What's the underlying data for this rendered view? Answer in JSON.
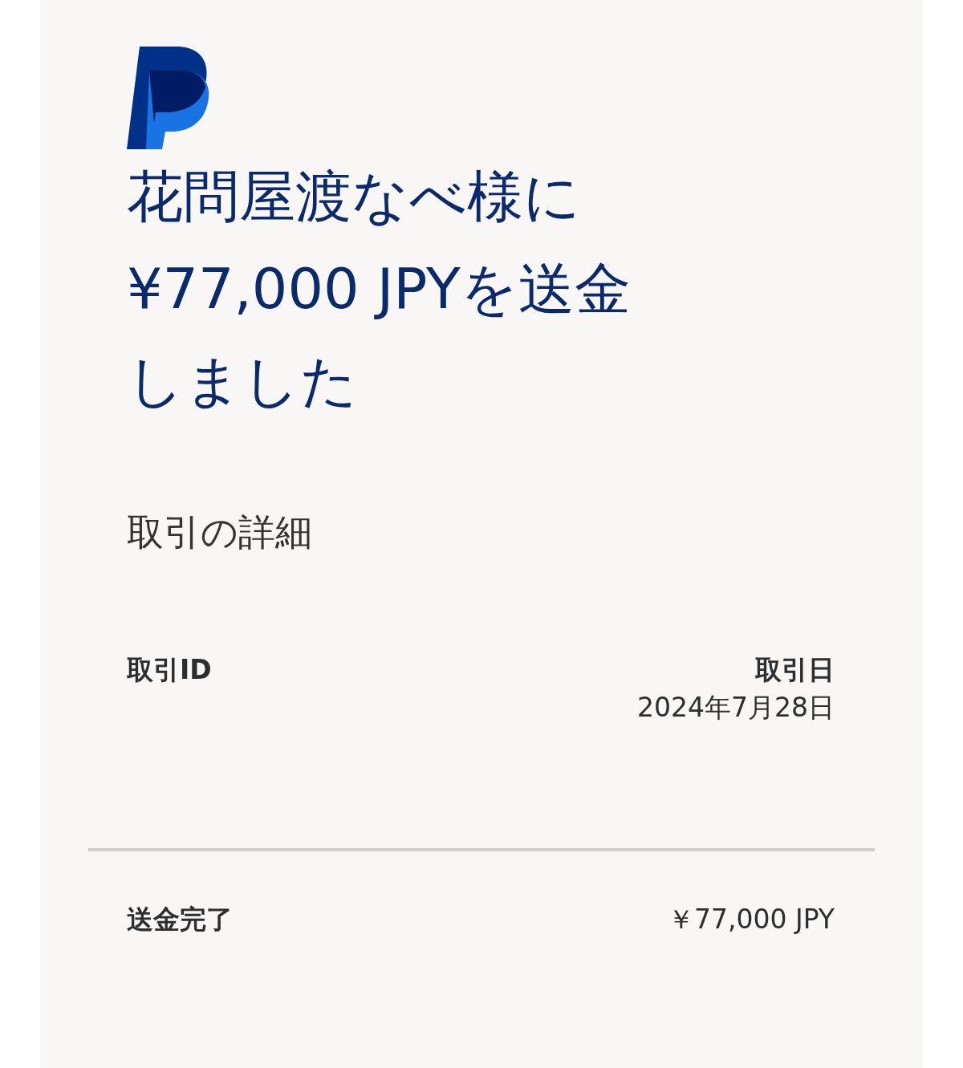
{
  "heading_lines": [
    "花問屋渡なべ様に",
    "¥77,000 JPYを送金",
    "しました"
  ],
  "section_title": "取引の詳細",
  "details": [
    {
      "label": "取引ID"
    },
    {
      "label": "取引日",
      "value": "2024年7月28日"
    }
  ],
  "summary": {
    "label": "送金完了",
    "amount": "￥77,000 JPY"
  }
}
